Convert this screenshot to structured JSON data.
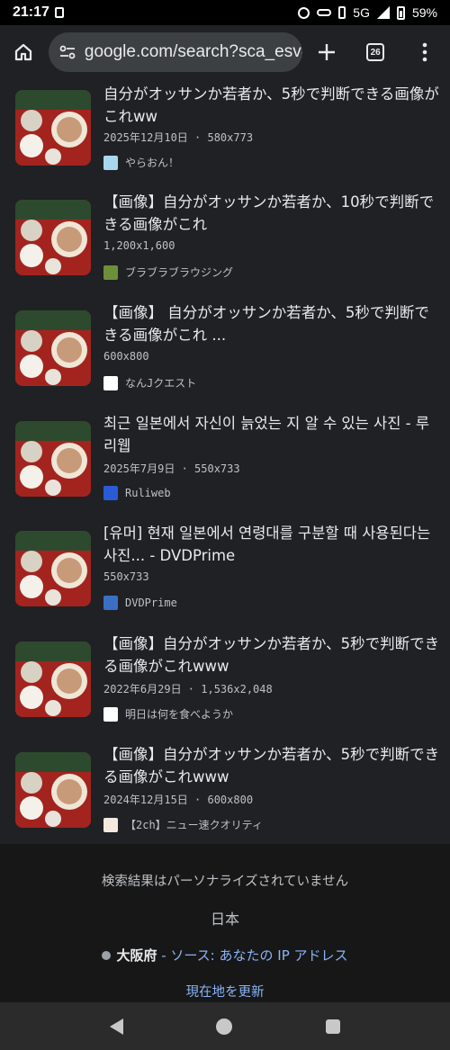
{
  "status_bar": {
    "time": "21:17",
    "network": "5G",
    "battery": "59%",
    "icons": [
      "alarm-icon",
      "key-icon",
      "vibrate-icon",
      "signal-icon",
      "battery-icon"
    ]
  },
  "toolbar": {
    "url": "google.com/search?sca_esv=(",
    "tab_count": "26",
    "icons": [
      "home-icon",
      "site-settings-icon",
      "new-tab-icon",
      "tab-switcher-icon",
      "menu-icon"
    ]
  },
  "results": [
    {
      "title": "自分がオッサンか若者か、5秒で判断できる画像がこれww",
      "meta": "2025年12月10日 · 580x773",
      "source": "やらおん！",
      "favicon_color": "#a8d8f0"
    },
    {
      "title": "【画像】自分がオッサンか若者か、10秒で判断できる画像がこれ",
      "meta": "1,200x1,600",
      "source": "ブラブラブラウジング",
      "favicon_color": "#6e8f3a"
    },
    {
      "title": "【画像】 自分がオッサンか若者か、5秒で判断できる画像がこれ ...",
      "meta": "600x800",
      "source": "なんJクエスト",
      "favicon_color": "#ffffff"
    },
    {
      "title": "최근 일본에서 자신이 늙었는 지 알 수 있는 사진 - 루리웹",
      "meta": "2025年7月9日 · 550x733",
      "source": "Ruliweb",
      "favicon_color": "#2a5bd7"
    },
    {
      "title": "[유머] 현재 일본에서 연령대를 구분할 때 사용된다는 사진... - DVDPrime",
      "meta": "550x733",
      "source": "DVDPrime",
      "favicon_color": "#3a6fc4"
    },
    {
      "title": "【画像】自分がオッサンか若者か、5秒で判断できる画像がこれwww",
      "meta": "2022年6月29日 · 1,536x2,048",
      "source": "明日は何を食べようか",
      "favicon_color": "#ffffff"
    },
    {
      "title": "【画像】自分がオッサンか若者か、5秒で判断できる画像がこれwww",
      "meta": "2024年12月15日 · 600x800",
      "source": "【2ch】ニュー速クオリティ",
      "favicon_color": "#f3e9df"
    }
  ],
  "footer": {
    "note": "検索結果はパーソナライズされていません",
    "country": "日本",
    "city": "大阪府",
    "location_source": " - ソース: あなたの IP アドレス",
    "update_link": "現在地を更新"
  },
  "navbar": {
    "icons": [
      "back-icon",
      "home-icon",
      "recents-icon"
    ]
  }
}
